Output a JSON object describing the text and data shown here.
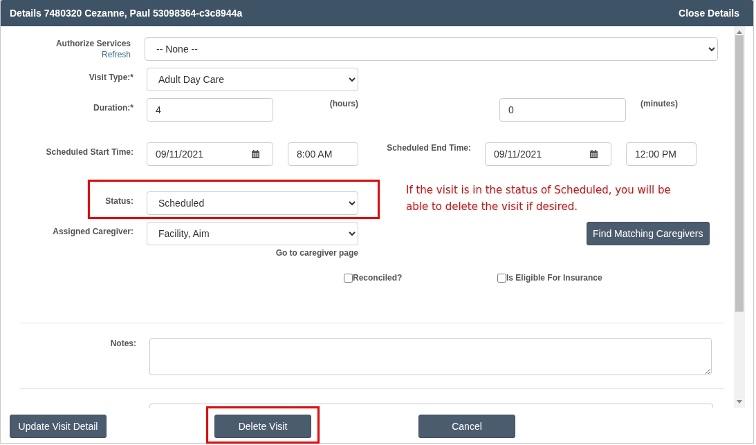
{
  "header": {
    "title": "Details 7480320 Cezanne, Paul 53098364-c3c8944a",
    "close": "Close Details"
  },
  "authorize_services": {
    "label": "Authorize Services",
    "refresh_link": "Refresh",
    "value": "-- None --"
  },
  "visit_type": {
    "label": "Visit Type:*",
    "value": "Adult Day Care"
  },
  "duration": {
    "label": "Duration:*",
    "hours": {
      "value": "4",
      "unit": "(hours)"
    },
    "minutes": {
      "value": "0",
      "unit": "(minutes)"
    }
  },
  "scheduled_start": {
    "label": "Scheduled Start Time:",
    "date": "09/11/2021",
    "time": "8:00 AM"
  },
  "scheduled_end": {
    "label": "Scheduled End Time:",
    "date": "09/11/2021",
    "time": "12:00 PM"
  },
  "status": {
    "label": "Status:",
    "value": "Scheduled"
  },
  "callout": {
    "text": "If the visit is in the status of Scheduled, you will be able to delete the visit if desired."
  },
  "assigned_caregiver": {
    "label": "Assigned Caregiver:",
    "value": "Facility, Aim",
    "link": "Go to caregiver page"
  },
  "find_button": "Find Matching Caregivers",
  "checkboxes": [
    {
      "label": "Reconciled?",
      "checked": false
    },
    {
      "label": "Is Eligible For Insurance",
      "checked": false
    }
  ],
  "notes": {
    "label": "Notes:"
  },
  "buttons": [
    {
      "label": "Update Visit Detail",
      "highlighted": false
    },
    {
      "label": "Delete Visit",
      "highlighted": true
    },
    {
      "label": "Cancel",
      "highlighted": false
    }
  ]
}
